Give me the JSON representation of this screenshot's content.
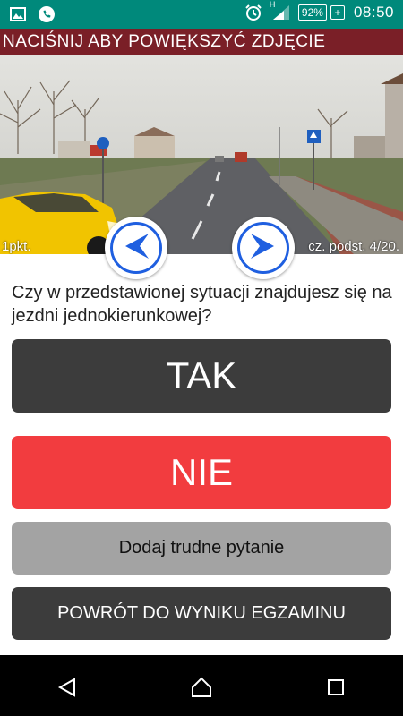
{
  "status_bar": {
    "time": "08:50",
    "battery": "92%",
    "network": "H"
  },
  "photo": {
    "banner": "NACIŚNIJ ABY POWIĘKSZYĆ ZDJĘCIE",
    "points": "1pkt.",
    "question_number": "cz. podst. 4/20."
  },
  "question": {
    "text": "Czy w przedstawionej sytuacji znajdujesz się na jezdni jednokierunkowej?"
  },
  "buttons": {
    "yes": "TAK",
    "no": "NIE",
    "add_hard": "Dodaj trudne pytanie",
    "back": "POWRÓT DO WYNIKU EGZAMINU"
  },
  "colors": {
    "status_bar": "#00897b",
    "banner": "#7a1f27",
    "yes_button": "#3c3c3c",
    "no_button": "#f23c3f",
    "hard_button": "#a3a3a3",
    "arrow": "#1f5fe0"
  },
  "icons": {
    "status_left": [
      "image-icon",
      "phone-icon"
    ],
    "status_right": [
      "alarm-icon",
      "signal-icon",
      "battery-icon"
    ],
    "nav": [
      "back-icon",
      "home-icon",
      "recents-icon"
    ],
    "prev": "arrow-left-icon",
    "next": "arrow-right-icon"
  }
}
